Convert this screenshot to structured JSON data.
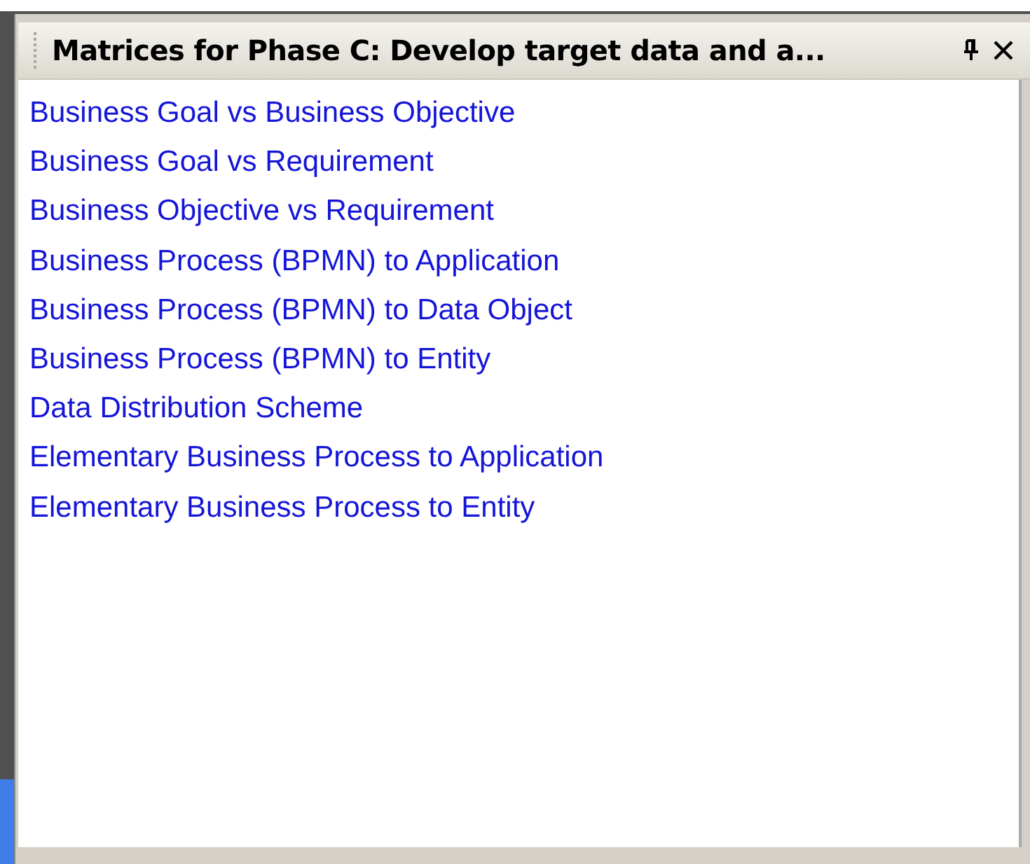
{
  "panel": {
    "title": "Matrices for Phase C: Develop target data and a...",
    "items": [
      {
        "label": "Business Goal vs Business Objective"
      },
      {
        "label": "Business Goal vs Requirement"
      },
      {
        "label": "Business Objective vs Requirement"
      },
      {
        "label": "Business Process (BPMN) to Application"
      },
      {
        "label": "Business Process (BPMN) to Data Object"
      },
      {
        "label": "Business Process (BPMN) to Entity"
      },
      {
        "label": "Data Distribution Scheme"
      },
      {
        "label": "Elementary Business Process to Application"
      },
      {
        "label": "Elementary Business Process to Entity"
      }
    ]
  }
}
